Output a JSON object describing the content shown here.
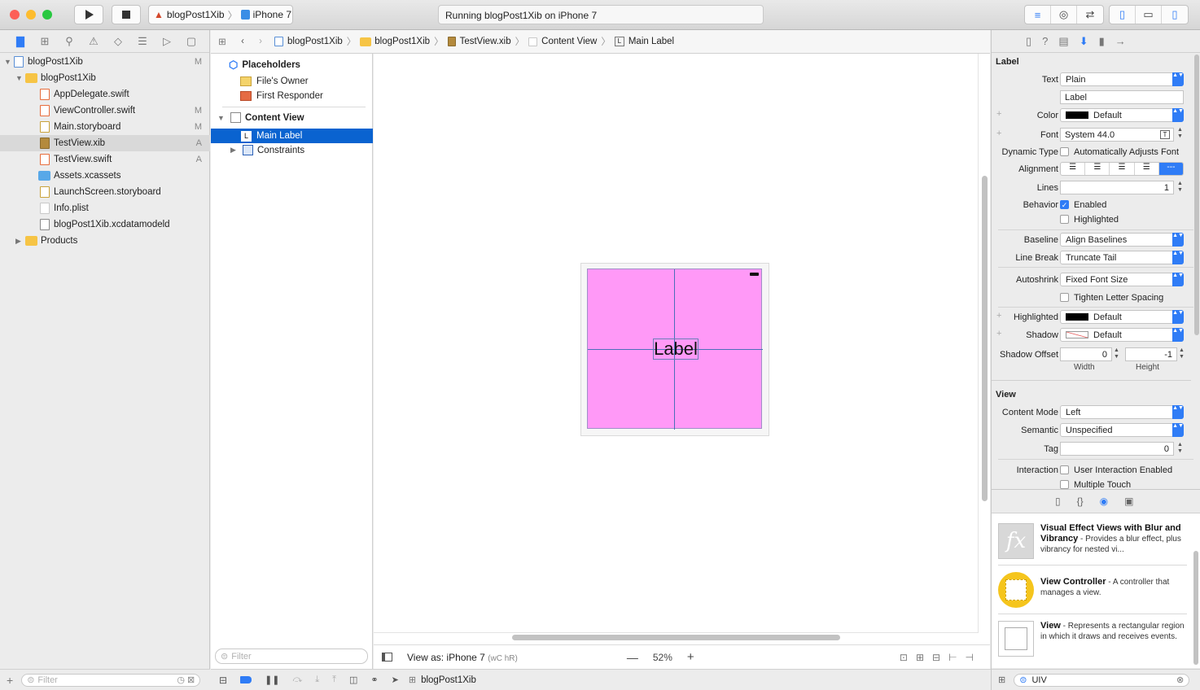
{
  "toolbar": {
    "scheme_project": "blogPost1Xib",
    "scheme_device": "iPhone 7",
    "activity": "Running blogPost1Xib on iPhone 7"
  },
  "navigator": {
    "items": [
      {
        "label": "blogPost1Xib",
        "status": "M"
      },
      {
        "label": "blogPost1Xib",
        "status": ""
      },
      {
        "label": "AppDelegate.swift",
        "status": ""
      },
      {
        "label": "ViewController.swift",
        "status": "M"
      },
      {
        "label": "Main.storyboard",
        "status": "M"
      },
      {
        "label": "TestView.xib",
        "status": "A"
      },
      {
        "label": "TestView.swift",
        "status": "A"
      },
      {
        "label": "Assets.xcassets",
        "status": ""
      },
      {
        "label": "LaunchScreen.storyboard",
        "status": ""
      },
      {
        "label": "Info.plist",
        "status": ""
      },
      {
        "label": "blogPost1Xib.xcdatamodeld",
        "status": ""
      },
      {
        "label": "Products",
        "status": ""
      }
    ],
    "filter_placeholder": "Filter"
  },
  "jumpbar": {
    "crumbs": [
      "blogPost1Xib",
      "blogPost1Xib",
      "TestView.xib",
      "Content View",
      "Main Label"
    ]
  },
  "outline": {
    "placeholders": "Placeholders",
    "files_owner": "File's Owner",
    "first_responder": "First Responder",
    "content_view": "Content View",
    "main_label": "Main Label",
    "constraints": "Constraints",
    "filter_placeholder": "Filter"
  },
  "canvas": {
    "label_text": "Label",
    "view_as": "View as: iPhone 7",
    "size_class": "(wC hR)",
    "zoom": "52%",
    "bg_color": "#ff99f7"
  },
  "inspector": {
    "label_section": "Label",
    "text_label": "Text",
    "text_value": "Plain",
    "text_content": "Label",
    "color_label": "Color",
    "color_value": "Default",
    "font_label": "Font",
    "font_value": "System 44.0",
    "dynamic_type_label": "Dynamic Type",
    "dynamic_type_value": "Automatically Adjusts Font",
    "alignment_label": "Alignment",
    "lines_label": "Lines",
    "lines_value": "1",
    "behavior_label": "Behavior",
    "enabled": "Enabled",
    "highlighted": "Highlighted",
    "baseline_label": "Baseline",
    "baseline_value": "Align Baselines",
    "linebreak_label": "Line Break",
    "linebreak_value": "Truncate Tail",
    "autoshrink_label": "Autoshrink",
    "autoshrink_value": "Fixed Font Size",
    "tighten": "Tighten Letter Spacing",
    "highlighted_label": "Highlighted",
    "highlighted_value": "Default",
    "shadow_label": "Shadow",
    "shadow_value": "Default",
    "shadow_offset_label": "Shadow Offset",
    "shadow_width": "0",
    "shadow_height": "-1",
    "width_caption": "Width",
    "height_caption": "Height",
    "view_section": "View",
    "content_mode_label": "Content Mode",
    "content_mode_value": "Left",
    "semantic_label": "Semantic",
    "semantic_value": "Unspecified",
    "tag_label": "Tag",
    "tag_value": "0",
    "interaction_label": "Interaction",
    "user_interaction": "User Interaction Enabled",
    "multiple_touch": "Multiple Touch"
  },
  "library": {
    "items": [
      {
        "title": "Visual Effect Views with Blur and Vibrancy",
        "desc": " - Provides a blur effect, plus vibrancy for nested vi..."
      },
      {
        "title": "View Controller",
        "desc": " - A controller that manages a view."
      },
      {
        "title": "View",
        "desc": " - Represents a rectangular region in which it draws and receives events."
      }
    ],
    "search_value": "UIV"
  },
  "debugbar": {
    "target": "blogPost1Xib"
  }
}
